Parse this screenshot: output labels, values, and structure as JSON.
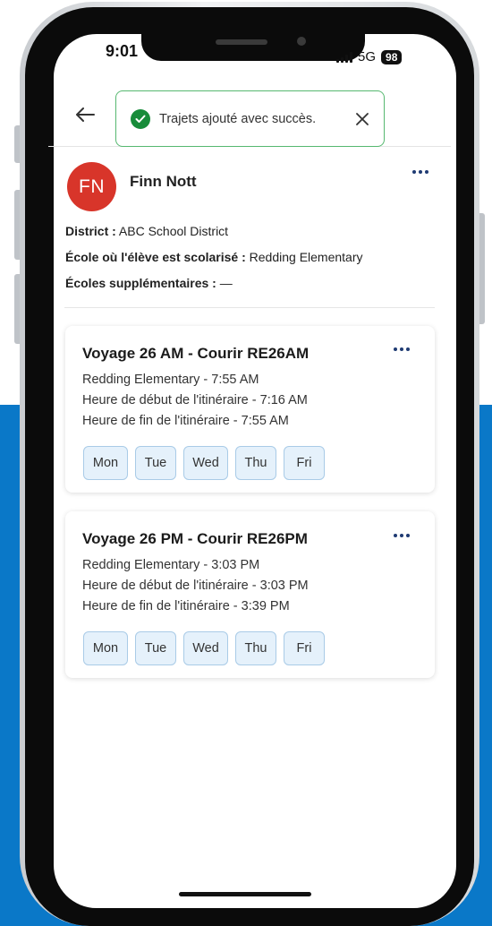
{
  "status_bar": {
    "time": "9:01",
    "network": "5G",
    "battery": "98"
  },
  "toast": {
    "message": "Trajets ajouté avec succès.",
    "icon": "check-circle-icon",
    "border_color": "#56b870",
    "icon_color": "#188c3a"
  },
  "student": {
    "initials": "FN",
    "name": "Finn Nott",
    "avatar_color": "#d8352a",
    "district_label": "District :",
    "district_value": "ABC School District",
    "school_label": "École où l'élève est scolarisé :",
    "school_value": "Redding Elementary",
    "extra_schools_label": "Écoles supplémentaires :",
    "extra_schools_value": "—"
  },
  "trips": [
    {
      "title": "Voyage 26 AM - Courir RE26AM",
      "school_time": "Redding Elementary - 7:55 AM",
      "start_time": "Heure de début de l'itinéraire - 7:16 AM",
      "end_time": "Heure de fin de l'itinéraire - 7:55 AM",
      "days": [
        "Mon",
        "Tue",
        "Wed",
        "Thu",
        "Fri"
      ]
    },
    {
      "title": "Voyage 26 PM - Courir RE26PM",
      "school_time": "Redding Elementary - 3:03 PM",
      "start_time": "Heure de début de l'itinéraire - 3:03 PM",
      "end_time": "Heure de fin de l'itinéraire - 3:39 PM",
      "days": [
        "Mon",
        "Tue",
        "Wed",
        "Thu",
        "Fri"
      ]
    }
  ],
  "colors": {
    "background_accent": "#0a78c8",
    "day_chip_bg": "#e5f1fb",
    "day_chip_border": "#a9cbe7",
    "more_icon": "#1f3b73"
  }
}
